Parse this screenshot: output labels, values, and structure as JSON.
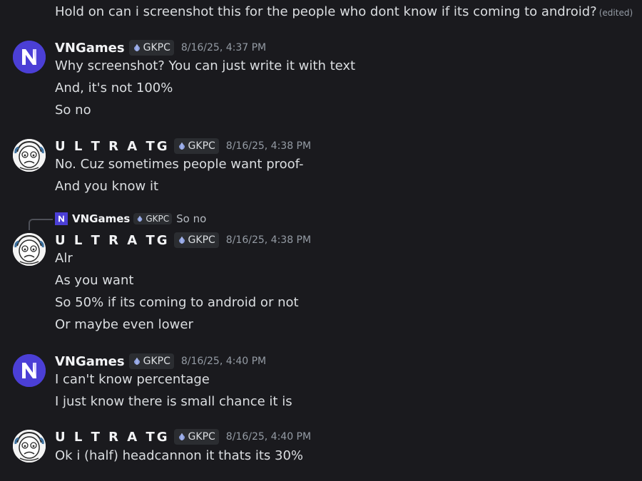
{
  "messages": {
    "m0": {
      "lines": [
        "Hold on can i screenshot this for the people who dont know if its coming to android?"
      ],
      "edited": "(edited)"
    },
    "m1": {
      "author": "VNGames",
      "tag": "GKPC",
      "time": "8/16/25, 4:37 PM",
      "lines": [
        "Why screenshot? You can just write it with text",
        "And, it's not 100%",
        "So no"
      ]
    },
    "m2": {
      "author": "U L T R A TG",
      "tag": "GKPC",
      "time": "8/16/25, 4:38 PM",
      "lines": [
        "No. Cuz sometimes people want proof-",
        "And you know it"
      ]
    },
    "m3": {
      "reply": {
        "author": "VNGames",
        "tag": "GKPC",
        "text": "So no"
      },
      "author": "U L T R A TG",
      "tag": "GKPC",
      "time": "8/16/25, 4:38 PM",
      "lines": [
        "Alr",
        "As you want",
        "So 50% if its coming to android or not",
        "Or maybe even lower"
      ]
    },
    "m4": {
      "author": "VNGames",
      "tag": "GKPC",
      "time": "8/16/25, 4:40 PM",
      "lines": [
        "I can't know percentage",
        "I just know there is small chance it is"
      ]
    },
    "m5": {
      "author": "U L T R A TG",
      "tag": "GKPC",
      "time": "8/16/25, 4:40 PM",
      "lines": [
        "Ok i (half) headcannon it thats its 30%"
      ]
    }
  },
  "icons": {
    "tag_icon": "gem-icon",
    "vn_avatar": "vn-logo-avatar",
    "ultra_avatar": "cartoon-face-avatar"
  },
  "colors": {
    "background": "#1a1a1e",
    "tag_bg": "#2b2d31",
    "tag_gem": "#8ea1e1",
    "vn_avatar": "#4b3fd6"
  }
}
